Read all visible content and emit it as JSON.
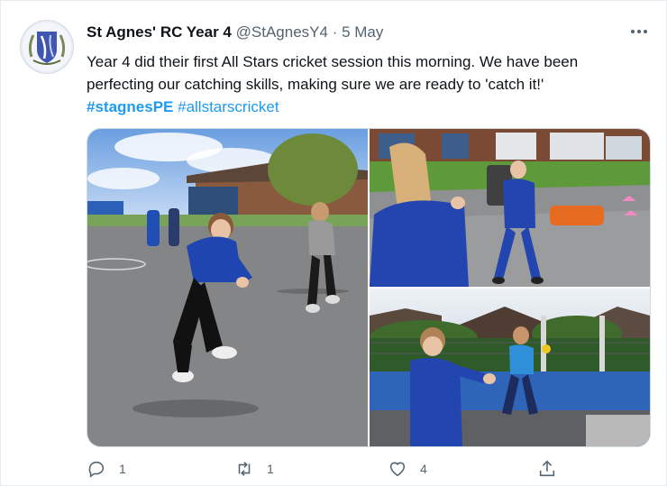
{
  "tweet": {
    "author_name": "St Agnes' RC Year 4",
    "handle": "@StAgnesY4",
    "separator": "·",
    "date": "5 May",
    "more_icon": "more-dots-icon",
    "text_line1": "Year 4 did their first All Stars cricket session this morning. We have been",
    "text_line2": "perfecting our catching skills, making sure we are ready to 'catch it!'",
    "hashtag1": "#stagnesPE",
    "hashtag2": "#allstarscricket"
  },
  "media": {
    "photos": [
      {
        "subject": "child in blue hoodie preparing to catch on playground"
      },
      {
        "subject": "two children practicing catching near cricket kit"
      },
      {
        "subject": "children catching a ball on blue sports court"
      }
    ]
  },
  "actions": {
    "reply_count": "1",
    "retweet_count": "1",
    "like_count": "4",
    "reply_icon": "reply-icon",
    "retweet_icon": "retweet-icon",
    "like_icon": "heart-icon",
    "share_icon": "share-icon"
  },
  "colors": {
    "text": "#0f1419",
    "secondary": "#536471",
    "link": "#1d9bf0",
    "border": "#cfd9de"
  }
}
